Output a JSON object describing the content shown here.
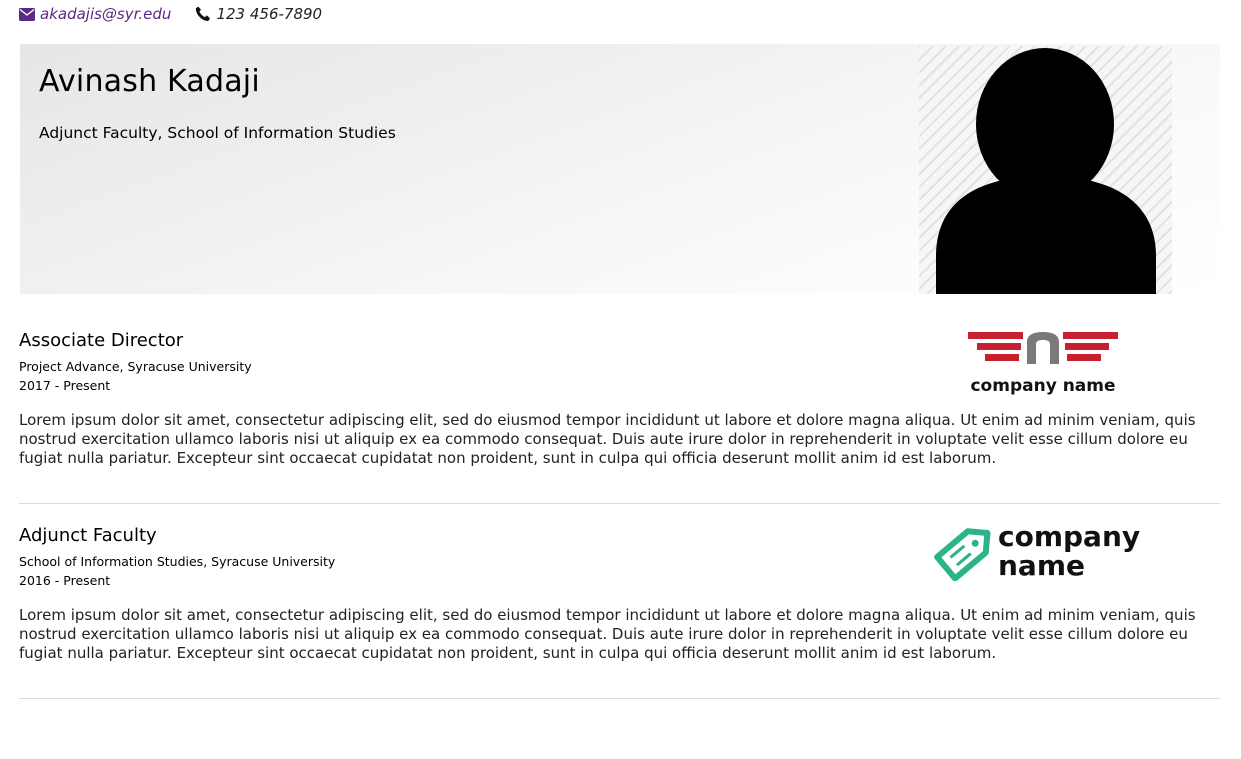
{
  "contact": {
    "email": "akadajis@syr.edu",
    "phone": "123 456-7890",
    "email_icon": "envelope-icon",
    "phone_icon": "phone-icon"
  },
  "profile": {
    "name": "Avinash Kadaji",
    "title": "Adjunct Faculty, School of Information Studies",
    "avatar_icon": "person-silhouette-icon"
  },
  "experience": [
    {
      "title": "Associate Director",
      "organization": "Project Advance, Syracuse University",
      "dates": "2017 - Present",
      "description": "Lorem ipsum dolor sit amet, consectetur adipiscing elit, sed do eiusmod tempor incididunt ut labore et dolore magna aliqua. Ut enim ad minim veniam, quis nostrud exercitation ullamco laboris nisi ut aliquip ex ea commodo consequat. Duis aute irure dolor in reprehenderit in voluptate velit esse cillum dolore eu fugiat nulla pariatur. Excepteur sint occaecat cupidatat non proident, sunt in culpa qui officia deserunt mollit anim id est laborum.",
      "logo_text": "company name"
    },
    {
      "title": "Adjunct Faculty",
      "organization": "School of Information Studies, Syracuse University",
      "dates": "2016 - Present",
      "description": "Lorem ipsum dolor sit amet, consectetur adipiscing elit, sed do eiusmod tempor incididunt ut labore et dolore magna aliqua. Ut enim ad minim veniam, quis nostrud exercitation ullamco laboris nisi ut aliquip ex ea commodo consequat. Duis aute irure dolor in reprehenderit in voluptate velit esse cillum dolore eu fugiat nulla pariatur. Excepteur sint occaecat cupidatat non proident, sunt in culpa qui officia deserunt mollit anim id est laborum.",
      "logo_text_line1": "company",
      "logo_text_line2": "name"
    }
  ],
  "colors": {
    "link": "#5b2a86",
    "logo_red": "#c8202f",
    "logo_gray": "#7a7a7a",
    "logo_teal": "#2bb38a"
  }
}
